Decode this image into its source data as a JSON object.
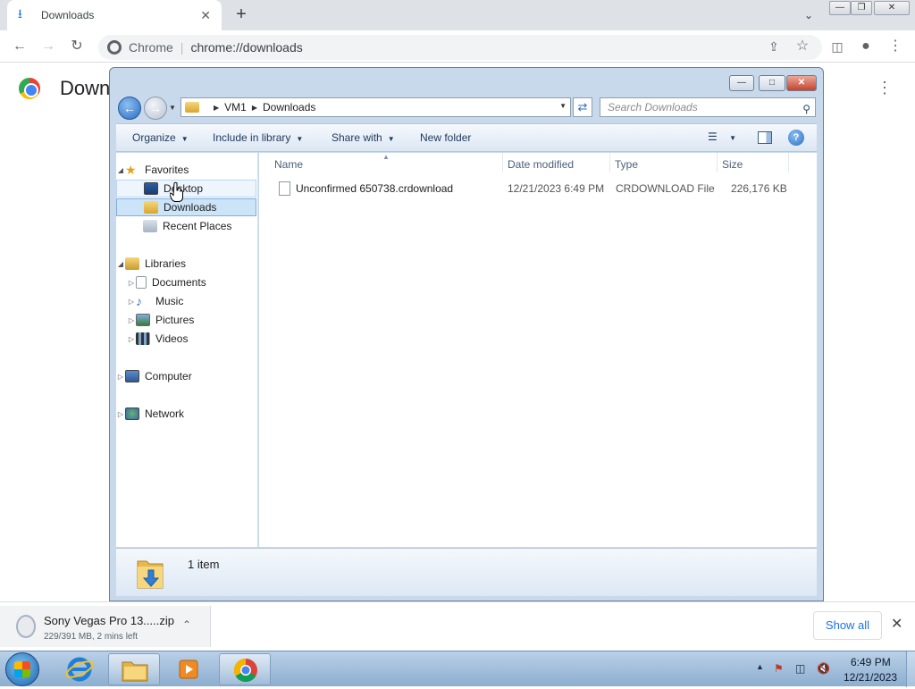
{
  "chrome": {
    "tab_title": "Downloads",
    "omnibox_prefix": "Chrome",
    "omnibox_url": "chrome://downloads",
    "page_title": "Down"
  },
  "explorer": {
    "breadcrumb": [
      "VM1",
      "Downloads"
    ],
    "search_placeholder": "Search Downloads",
    "toolbar": {
      "organize": "Organize",
      "include_in_library": "Include in library",
      "share_with": "Share with",
      "new_folder": "New folder"
    },
    "nav": {
      "favorites": "Favorites",
      "desktop": "Desktop",
      "downloads": "Downloads",
      "recent_places": "Recent Places",
      "libraries": "Libraries",
      "documents": "Documents",
      "music": "Music",
      "pictures": "Pictures",
      "videos": "Videos",
      "computer": "Computer",
      "network": "Network"
    },
    "columns": {
      "name": "Name",
      "date_modified": "Date modified",
      "type": "Type",
      "size": "Size"
    },
    "files": [
      {
        "name": "Unconfirmed 650738.crdownload",
        "date_modified": "12/21/2023 6:49 PM",
        "type": "CRDOWNLOAD File",
        "size": "226,176 KB"
      }
    ],
    "status_text": "1 item"
  },
  "download_shelf": {
    "file_name": "Sony Vegas Pro 13.....zip",
    "status": "229/391 MB, 2 mins left",
    "show_all": "Show all"
  },
  "taskbar": {
    "time": "6:49 PM",
    "date": "12/21/2023"
  },
  "colors": {
    "chrome_accent": "#1a73e8",
    "explorer_frame": "#c8d9ec",
    "nav_selected": "#cce4f7"
  }
}
